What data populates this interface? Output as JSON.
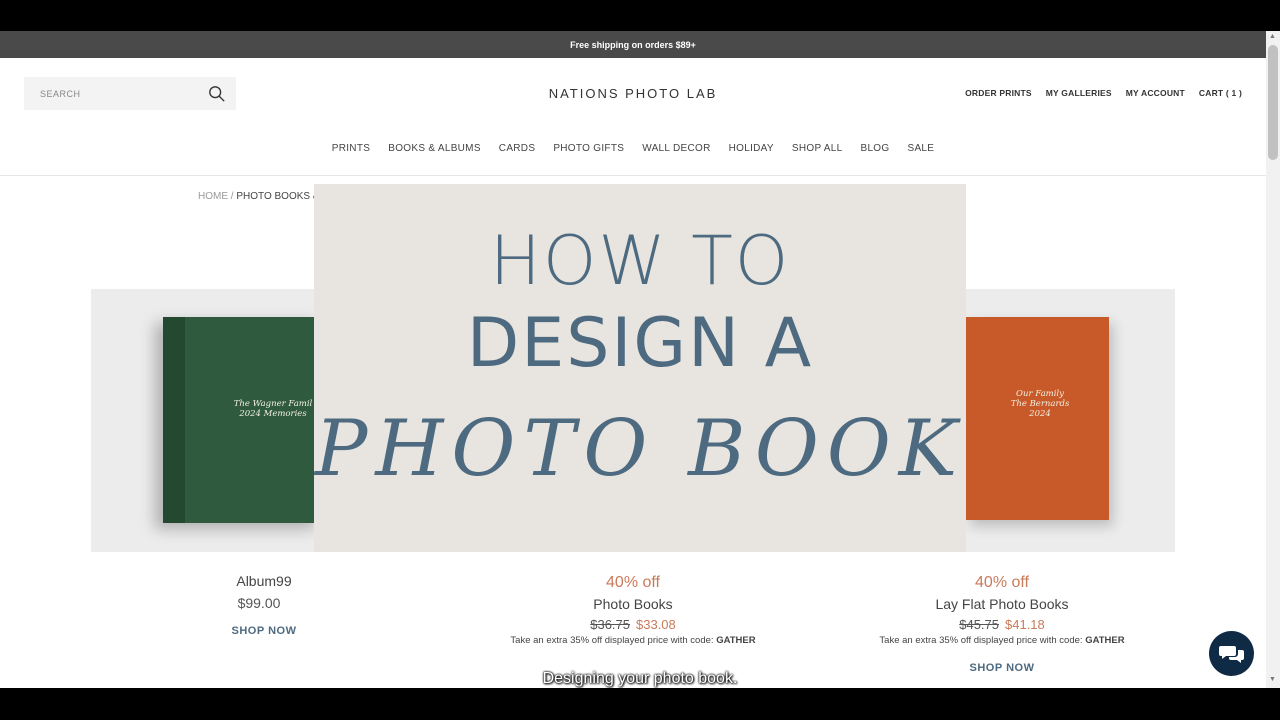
{
  "announcement": "Free shipping on orders $89+",
  "search": {
    "placeholder": "SEARCH"
  },
  "logo": "NATIONS PHOTO LAB",
  "utility_nav": [
    "ORDER PRINTS",
    "MY GALLERIES",
    "MY ACCOUNT",
    "CART ( 1 )"
  ],
  "main_nav": [
    "PRINTS",
    "BOOKS & ALBUMS",
    "CARDS",
    "PHOTO GIFTS",
    "WALL DECOR",
    "HOLIDAY",
    "SHOP ALL",
    "BLOG",
    "SALE"
  ],
  "breadcrumb": {
    "home": "HOME",
    "separator": "/",
    "current": "PHOTO BOOKS &"
  },
  "overlay": {
    "line1": "HOW TO",
    "line2": "DESIGN A",
    "line3": "PHOTO BOOK"
  },
  "products": [
    {
      "name": "Album99",
      "price": "$99.00",
      "shop": "SHOP NOW",
      "cover_text": [
        "The Wagner Famil",
        "2024 Memories"
      ]
    },
    {
      "discount": "40% off",
      "name": "Photo Books",
      "old_price": "$36.75",
      "new_price": "$33.08",
      "promo_text": "Take an extra 35% off displayed price with code:",
      "promo_code": "GATHER"
    },
    {
      "discount": "40% off",
      "name": "Lay Flat Photo Books",
      "old_price": "$45.75",
      "new_price": "$41.18",
      "promo_text": "Take an extra 35% off displayed price with code:",
      "promo_code": "GATHER",
      "shop": "SHOP NOW",
      "cover_text": [
        "Our Family",
        "The Bernards",
        "2024"
      ]
    }
  ],
  "caption": "Designing your photo book.",
  "colors": {
    "accent": "#4d6a80",
    "sale": "#c97a5a",
    "chat": "#0f2a44",
    "green_book": "#2f5a3d",
    "orange_book": "#c75a28"
  }
}
